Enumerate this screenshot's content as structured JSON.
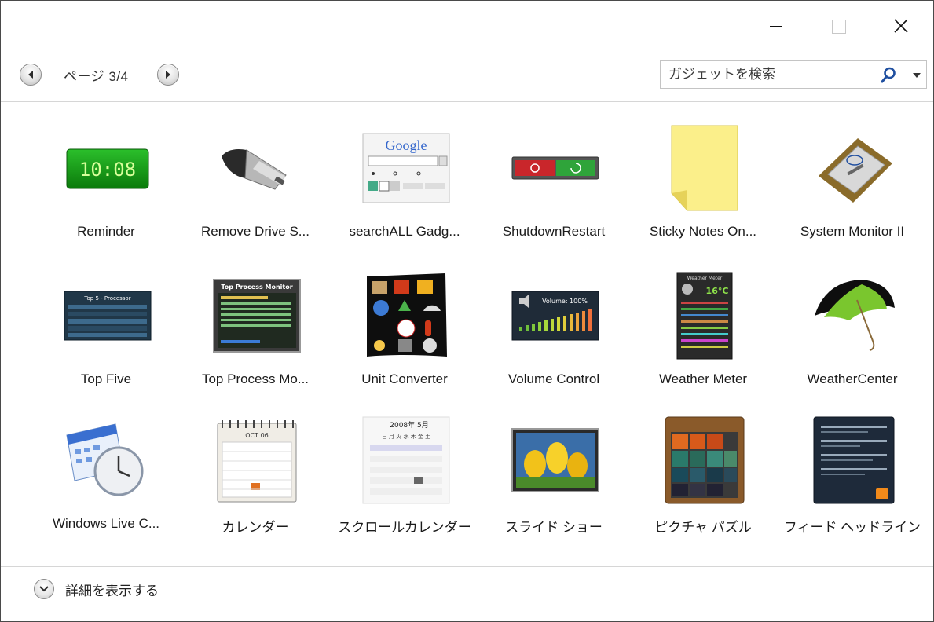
{
  "window": {
    "caption": {
      "minimize_icon": "minimize-icon",
      "maximize_icon": "maximize-icon",
      "close_icon": "close-icon"
    }
  },
  "toolbar": {
    "prev_icon": "triangle-left-icon",
    "next_icon": "triangle-right-icon",
    "page_label": "ページ 3/4",
    "search": {
      "placeholder": "ガジェットを検索",
      "value": "",
      "search_icon": "magnifier-icon",
      "dropdown_icon": "chevron-down-icon"
    }
  },
  "gadgets": [
    {
      "label": "Reminder",
      "icon": "digital-clock-icon"
    },
    {
      "label": "Remove Drive S...",
      "icon": "usb-drive-icon"
    },
    {
      "label": "searchALL Gadg...",
      "icon": "google-search-icon"
    },
    {
      "label": "ShutdownRestart",
      "icon": "power-buttons-icon"
    },
    {
      "label": "Sticky Notes On...",
      "icon": "sticky-note-icon"
    },
    {
      "label": "System Monitor II",
      "icon": "cpu-chip-icon"
    },
    {
      "label": "Top Five",
      "icon": "top-five-panel-icon"
    },
    {
      "label": "Top Process Mo...",
      "icon": "process-monitor-icon"
    },
    {
      "label": "Unit Converter",
      "icon": "unit-converter-icon"
    },
    {
      "label": "Volume Control",
      "icon": "volume-meter-icon"
    },
    {
      "label": "Weather Meter",
      "icon": "weather-meter-icon"
    },
    {
      "label": "WeatherCenter",
      "icon": "umbrella-icon"
    },
    {
      "label": "Windows Live C...",
      "icon": "calendar-clock-icon"
    },
    {
      "label": "カレンダー",
      "icon": "spiral-calendar-icon"
    },
    {
      "label": "スクロールカレンダー",
      "icon": "scroll-calendar-icon"
    },
    {
      "label": "スライド ショー",
      "icon": "slideshow-photo-icon"
    },
    {
      "label": "ピクチャ パズル",
      "icon": "picture-puzzle-icon"
    },
    {
      "label": "フィード ヘッドライン",
      "icon": "feed-headlines-icon"
    }
  ],
  "thumbs": {
    "reminder_time": "10:08",
    "google_logo": "Google",
    "top_five_title": "Top 5 - Processor",
    "top_process_title": "Top Process Monitor",
    "volume_text": "Volume: 100%",
    "weather_title": "Weather Meter",
    "weather_temp": "16°C",
    "calendar_month": "OCT 06",
    "scroll_cal_header": "2008年 5月",
    "scroll_cal_weekdays": "日 月 火 水 木 金 土"
  },
  "footer": {
    "toggle_icon": "chevron-down-circle-icon",
    "label": "詳細を表示する"
  }
}
